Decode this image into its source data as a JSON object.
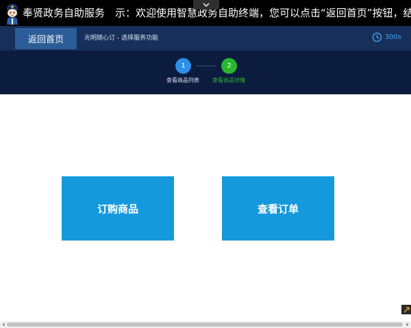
{
  "header": {
    "app_title": "奉贤政务自助服务",
    "marquee_text": "示：欢迎使用智慧政务自助终端，您可以点击“返回首页”按钮，结束当前操作"
  },
  "nav": {
    "home_button_label": "返回首页",
    "breadcrumb": "光明随心订 - 选择服务功能",
    "countdown": "300s"
  },
  "steps": [
    {
      "number": "1",
      "label": "查看商品列表",
      "color": "#2e8fe8"
    },
    {
      "number": "2",
      "label": "查看商品详情",
      "color": "#2ab62f"
    }
  ],
  "actions": {
    "order_label": "订购商品",
    "view_orders_label": "查看订单"
  },
  "icons": {
    "collapse": "chevron-down-icon",
    "mascot": "mascot-icon",
    "timer": "clock-icon",
    "corner": "expand-icon"
  },
  "colors": {
    "title_bar": "#000000",
    "nav_bar": "#16305a",
    "steps_bar": "#0c1c3e",
    "home_button": "#2d5d98",
    "tile": "#1499dc",
    "step_active": "#2ab62f",
    "step_done": "#2e8fe8"
  }
}
